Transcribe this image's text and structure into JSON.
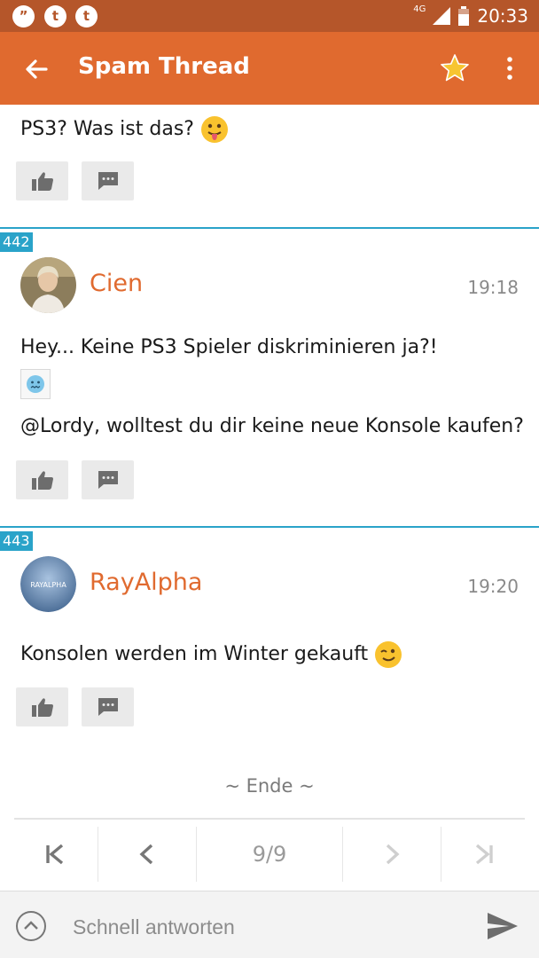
{
  "status_bar": {
    "time": "20:33",
    "network": "4G",
    "notifications": [
      {
        "icon": "quote-icon",
        "glyph": "”"
      },
      {
        "icon": "tapatalk-icon",
        "glyph": "t"
      },
      {
        "icon": "tapatalk-icon",
        "glyph": "t"
      }
    ]
  },
  "app_bar": {
    "title": "Spam Thread",
    "back_icon": "arrow-left-icon",
    "star_icon": "star-icon",
    "menu_icon": "more-vertical-icon"
  },
  "posts": [
    {
      "text": "PS3? Was ist das?",
      "emoji": "tongue-face-emoji"
    },
    {
      "number": "442",
      "username": "Cien",
      "time": "19:18",
      "line1": "Hey... Keine PS3 Spieler diskriminieren ja?!",
      "inline_emoji": "cold-face-emoji",
      "line2": "@Lordy, wolltest du dir keine neue Konsole kaufen?"
    },
    {
      "number": "443",
      "username": "RayAlpha",
      "avatar_text": "RAYALPHA",
      "time": "19:20",
      "text": "Konsolen werden im Winter gekauft",
      "emoji": "wink-face-emoji"
    }
  ],
  "actions": {
    "like_icon": "thumbs-up-icon",
    "reply_icon": "comment-icon"
  },
  "footer": {
    "end_label": "~ Ende ~",
    "page_indicator": "9/9"
  },
  "pagination": {
    "first_icon": "first-page-icon",
    "prev_icon": "chevron-left-icon",
    "next_icon": "chevron-right-icon",
    "last_icon": "last-page-icon"
  },
  "quick_reply": {
    "placeholder": "Schnell antworten",
    "expand_icon": "expand-up-icon",
    "send_icon": "send-icon"
  },
  "colors": {
    "status_bar": "#b5562a",
    "app_bar": "#e06a2f",
    "username": "#e06a2f",
    "divider": "#2aa3c9"
  }
}
